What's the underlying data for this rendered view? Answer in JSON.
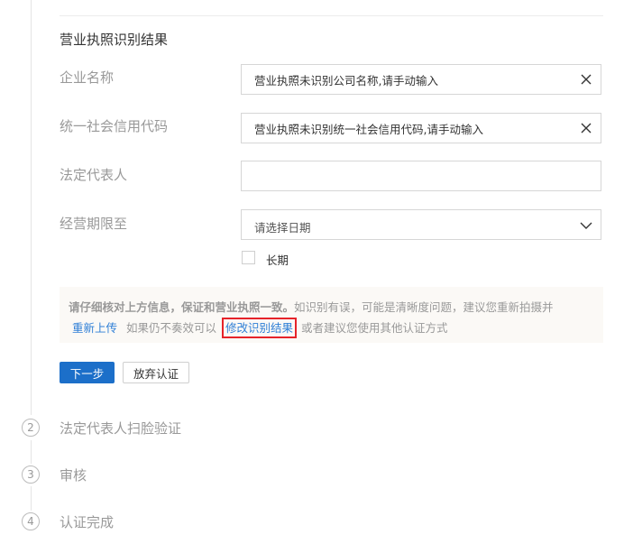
{
  "section": {
    "title": "营业执照识别结果"
  },
  "form": {
    "company_name": {
      "label": "企业名称",
      "value": "营业执照未识别公司名称,请手动输入"
    },
    "credit_code": {
      "label": "统一社会信用代码",
      "value": "营业执照未识别统一社会信用代码,请手动输入"
    },
    "legal_rep": {
      "label": "法定代表人",
      "value": ""
    },
    "term": {
      "label": "经营期限至",
      "placeholder": "请选择日期"
    },
    "long_term": {
      "label": "长期",
      "checked": false
    }
  },
  "tip": {
    "bold": "请仔细核对上方信息，保证和营业执照一致。",
    "part1": "如识别有误，可能是清晰度问题，建议您重新拍摄并",
    "reupload": "重新上传",
    "part2": "如果仍不奏效可以",
    "edit_link": "修改识别结果",
    "part3": "或者建议您使用其他认证方式"
  },
  "buttons": {
    "next": "下一步",
    "abandon": "放弃认证"
  },
  "steps": [
    {
      "number": "2",
      "label": "法定代表人扫脸验证"
    },
    {
      "number": "3",
      "label": "审核"
    },
    {
      "number": "4",
      "label": "认证完成"
    }
  ],
  "colors": {
    "primary": "#1c6fc9",
    "link": "#2f7fd6",
    "highlight": "#e6232a"
  }
}
